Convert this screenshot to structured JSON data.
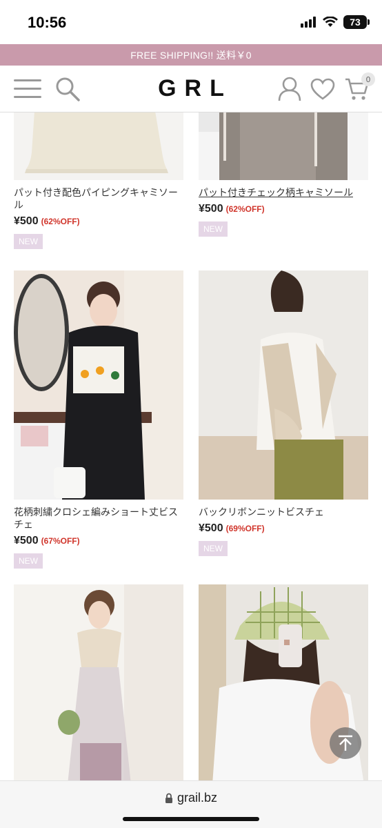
{
  "status_bar": {
    "time": "10:56",
    "battery": "73"
  },
  "banner": {
    "text": "FREE SHIPPING!! 送料￥0"
  },
  "header": {
    "logo": "GRL",
    "cart_count": "0"
  },
  "products": [
    {
      "name": "パット付き配色パイピングキャミソール",
      "price": "¥500",
      "discount": "(62%OFF)",
      "badge": "NEW"
    },
    {
      "name": "パット付きチェック柄キャミソール",
      "price": "¥500",
      "discount": "(62%OFF)",
      "badge": "NEW"
    },
    {
      "name": "花柄刺繍クロシェ編みショート丈ビスチェ",
      "price": "¥500",
      "discount": "(67%OFF)",
      "badge": "NEW"
    },
    {
      "name": "バックリボンニットビスチェ",
      "price": "¥500",
      "discount": "(69%OFF)",
      "badge": "NEW"
    },
    {
      "name": "",
      "price": "",
      "discount": "",
      "badge": ""
    },
    {
      "name": "",
      "price": "",
      "discount": "",
      "badge": ""
    }
  ],
  "browser": {
    "url": "grail.bz"
  },
  "colors": {
    "banner": "#c99aab",
    "discount": "#d0352b",
    "badge": "#e5d6e6"
  },
  "icons": [
    "menu-icon",
    "search-icon",
    "account-icon",
    "heart-icon",
    "cart-icon",
    "arrow-up-icon",
    "lock-icon"
  ]
}
